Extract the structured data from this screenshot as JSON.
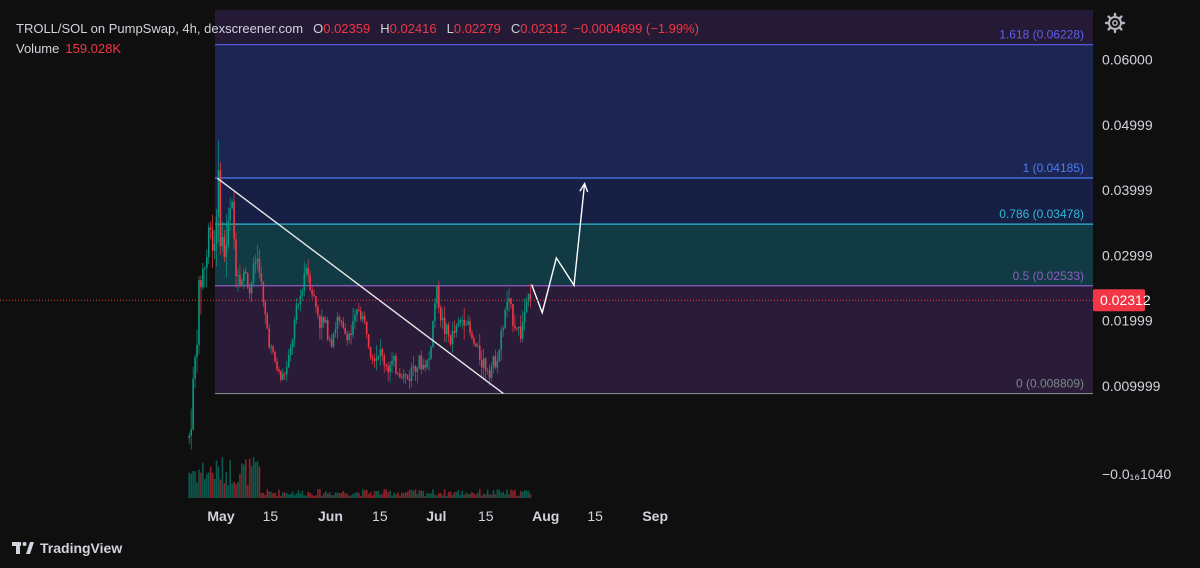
{
  "header": {
    "symbol": "TROLL/SOL on PumpSwap, 4h, dexscreener.com",
    "open_label": "O",
    "open": "0.02359",
    "high_label": "H",
    "high": "0.02416",
    "low_label": "L",
    "low": "0.02279",
    "close_label": "C",
    "close": "0.02312",
    "change": "−0.0004699 (−1.99%)",
    "volume_label": "Volume",
    "volume": "159.028K"
  },
  "footer": {
    "brand": "TradingView"
  },
  "icons": {
    "settings": "gear-icon",
    "logo": "tradingview-logo-icon"
  },
  "colors": {
    "up": "#089981",
    "down": "#f23645",
    "bg": "#0f0f0f",
    "fib_top": "#5e5ef0",
    "fib_1": "#4a7df7",
    "fib_786": "#2fb8d4",
    "fib_05": "#8f5dc4",
    "fib_0": "#7a8a8a",
    "zone_top": "#1c2650",
    "zone_mid": "#172044",
    "zone_teal": "#113a44",
    "zone_low": "#2a1b38"
  },
  "chart_data": {
    "type": "candlestick",
    "title": "TROLL/SOL on PumpSwap, 4h, dexscreener.com",
    "xlabel": "",
    "ylabel": "",
    "x_ticks": [
      "May",
      "15",
      "Jun",
      "15",
      "Jul",
      "15",
      "Aug",
      "15",
      "Sep"
    ],
    "y_ticks": [
      "0.06000",
      "0.04999",
      "0.03999",
      "0.02999",
      "0.01999",
      "0.009999",
      "−0.0₁₆1040"
    ],
    "ylim": [
      -0.0072,
      0.0676
    ],
    "last_price_label": "0.02312",
    "price_path": [
      [
        "2025-04-22",
        0.002
      ],
      [
        "2025-04-24",
        0.016
      ],
      [
        "2025-04-25",
        0.026
      ],
      [
        "2025-04-27",
        0.03
      ],
      [
        "2025-04-28",
        0.036
      ],
      [
        "2025-04-29",
        0.03
      ],
      [
        "2025-04-30",
        0.0418
      ],
      [
        "2025-05-01",
        0.033
      ],
      [
        "2025-05-02",
        0.03
      ],
      [
        "2025-05-04",
        0.038
      ],
      [
        "2025-05-05",
        0.03
      ],
      [
        "2025-05-07",
        0.026
      ],
      [
        "2025-05-08",
        0.028
      ],
      [
        "2025-05-09",
        0.024
      ],
      [
        "2025-05-11",
        0.03
      ],
      [
        "2025-05-12",
        0.028
      ],
      [
        "2025-05-13",
        0.022
      ],
      [
        "2025-05-15",
        0.016
      ],
      [
        "2025-05-16",
        0.014
      ],
      [
        "2025-05-18",
        0.011
      ],
      [
        "2025-05-20",
        0.013
      ],
      [
        "2025-05-22",
        0.02
      ],
      [
        "2025-05-24",
        0.025
      ],
      [
        "2025-05-25",
        0.029
      ],
      [
        "2025-05-27",
        0.024
      ],
      [
        "2025-05-29",
        0.02
      ],
      [
        "2025-05-31",
        0.019
      ],
      [
        "2025-06-01",
        0.017
      ],
      [
        "2025-06-03",
        0.02
      ],
      [
        "2025-06-05",
        0.018
      ],
      [
        "2025-06-07",
        0.018
      ],
      [
        "2025-06-09",
        0.022
      ],
      [
        "2025-06-11",
        0.019
      ],
      [
        "2025-06-13",
        0.015
      ],
      [
        "2025-06-15",
        0.015
      ],
      [
        "2025-06-17",
        0.013
      ],
      [
        "2025-06-19",
        0.013
      ],
      [
        "2025-06-21",
        0.012
      ],
      [
        "2025-06-23",
        0.011
      ],
      [
        "2025-06-25",
        0.014
      ],
      [
        "2025-06-27",
        0.013
      ],
      [
        "2025-06-29",
        0.014
      ],
      [
        "2025-07-01",
        0.025
      ],
      [
        "2025-07-03",
        0.019
      ],
      [
        "2025-07-05",
        0.017
      ],
      [
        "2025-07-07",
        0.019
      ],
      [
        "2025-07-09",
        0.021
      ],
      [
        "2025-07-11",
        0.017
      ],
      [
        "2025-07-13",
        0.015
      ],
      [
        "2025-07-15",
        0.013
      ],
      [
        "2025-07-17",
        0.013
      ],
      [
        "2025-07-19",
        0.016
      ],
      [
        "2025-07-21",
        0.023
      ],
      [
        "2025-07-23",
        0.02
      ],
      [
        "2025-07-25",
        0.018
      ],
      [
        "2025-07-27",
        0.025
      ],
      [
        "2025-07-28",
        0.02312
      ]
    ],
    "fibonacci": [
      {
        "level": "1.618",
        "price": 0.06228,
        "label": "1.618 (0.06228)"
      },
      {
        "level": "1",
        "price": 0.04185,
        "label": "1 (0.04185)"
      },
      {
        "level": "0.786",
        "price": 0.03478,
        "label": "0.786 (0.03478)"
      },
      {
        "level": "0.5",
        "price": 0.02533,
        "label": "0.5 (0.02533)"
      },
      {
        "level": "0",
        "price": 0.008809,
        "label": "0 (0.008809)"
      }
    ],
    "trendline": {
      "from": [
        "2025-04-30",
        0.0418
      ],
      "to": [
        "2025-07-20",
        0.0088
      ]
    },
    "projection": [
      [
        "2025-07-28",
        0.0255
      ],
      [
        "2025-07-31",
        0.0212
      ],
      [
        "2025-08-04",
        0.0296
      ],
      [
        "2025-08-09",
        0.0254
      ],
      [
        "2025-08-12",
        0.041
      ]
    ],
    "grid": false,
    "legend": "top-left"
  }
}
